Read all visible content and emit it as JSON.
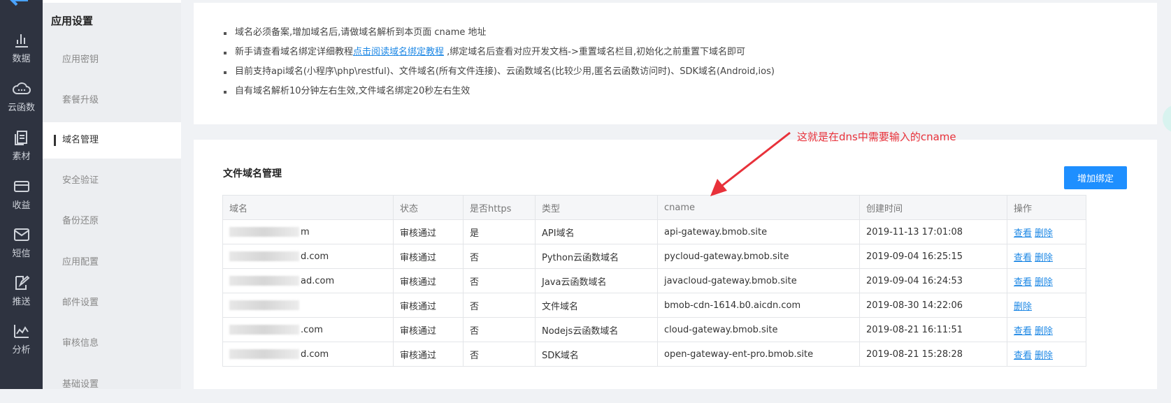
{
  "rail": [
    {
      "label": "数据",
      "icon": "bar-chart-icon"
    },
    {
      "label": "云函数",
      "icon": "cloud-icon"
    },
    {
      "label": "素材",
      "icon": "files-icon"
    },
    {
      "label": "收益",
      "icon": "card-icon"
    },
    {
      "label": "短信",
      "icon": "mail-icon"
    },
    {
      "label": "推送",
      "icon": "push-edit-icon"
    },
    {
      "label": "分析",
      "icon": "analysis-icon"
    }
  ],
  "subnav": {
    "title": "应用设置",
    "items": [
      "应用密钥",
      "套餐升级",
      "域名管理",
      "安全验证",
      "备份还原",
      "应用配置",
      "邮件设置",
      "审核信息",
      "基础设置"
    ],
    "active": "域名管理"
  },
  "notice": {
    "line1": "域名必须备案,增加域名后,请做域名解析到本页面 cname 地址",
    "line2_pre": "新手请查看域名绑定详细教程",
    "line2_link": "点击阅读域名绑定教程",
    "line2_post": " ,绑定域名后查看对应开发文档->重置域名栏目,初始化之前重置下域名即可",
    "line3": "目前支持api域名(小程序\\php\\restful)、文件域名(所有文件连接)、云函数域名(比较少用,匿名云函数访问时)、SDK域名(Android,ios)",
    "line4": "自有域名解析10分钟左右生效,文件域名绑定20秒左右生效"
  },
  "card": {
    "title": "文件域名管理",
    "add_button": "增加绑定"
  },
  "table": {
    "headers": [
      "域名",
      "状态",
      "是否https",
      "类型",
      "cname",
      "创建时间",
      "操作"
    ],
    "rows": [
      {
        "domain_suffix": "m",
        "status": "审核通过",
        "https": "是",
        "type": "API域名",
        "cname": "api-gateway.bmob.site",
        "created": "2019-11-13 17:01:08",
        "view": "查看",
        "delete": "删除"
      },
      {
        "domain_suffix": "d.com",
        "status": "审核通过",
        "https": "否",
        "type": "Python云函数域名",
        "cname": "pycloud-gateway.bmob.site",
        "created": "2019-09-04 16:25:15",
        "view": "查看",
        "delete": "删除"
      },
      {
        "domain_suffix": "ad.com",
        "status": "审核通过",
        "https": "否",
        "type": "Java云函数域名",
        "cname": "javacloud-gateway.bmob.site",
        "created": "2019-09-04 16:24:53",
        "view": "查看",
        "delete": "删除"
      },
      {
        "domain_suffix": "",
        "status": "审核通过",
        "https": "否",
        "type": "文件域名",
        "cname": "bmob-cdn-1614.b0.aicdn.com",
        "created": "2019-08-30 14:22:06",
        "view": "",
        "delete": "删除"
      },
      {
        "domain_suffix": ".com",
        "status": "审核通过",
        "https": "否",
        "type": "Nodejs云函数域名",
        "cname": "cloud-gateway.bmob.site",
        "created": "2019-08-21 16:11:51",
        "view": "查看",
        "delete": "删除"
      },
      {
        "domain_suffix": "d.com",
        "status": "审核通过",
        "https": "否",
        "type": "SDK域名",
        "cname": "open-gateway-ent-pro.bmob.site",
        "created": "2019-08-21 15:28:28",
        "view": "查看",
        "delete": "删除"
      }
    ]
  },
  "annotation": {
    "text": "这就是在dns中需要输入的cname",
    "color": "#e8313a"
  },
  "colors": {
    "rail_bg": "#2e3340",
    "link": "#1e88e5",
    "button": "#1e8fff"
  }
}
